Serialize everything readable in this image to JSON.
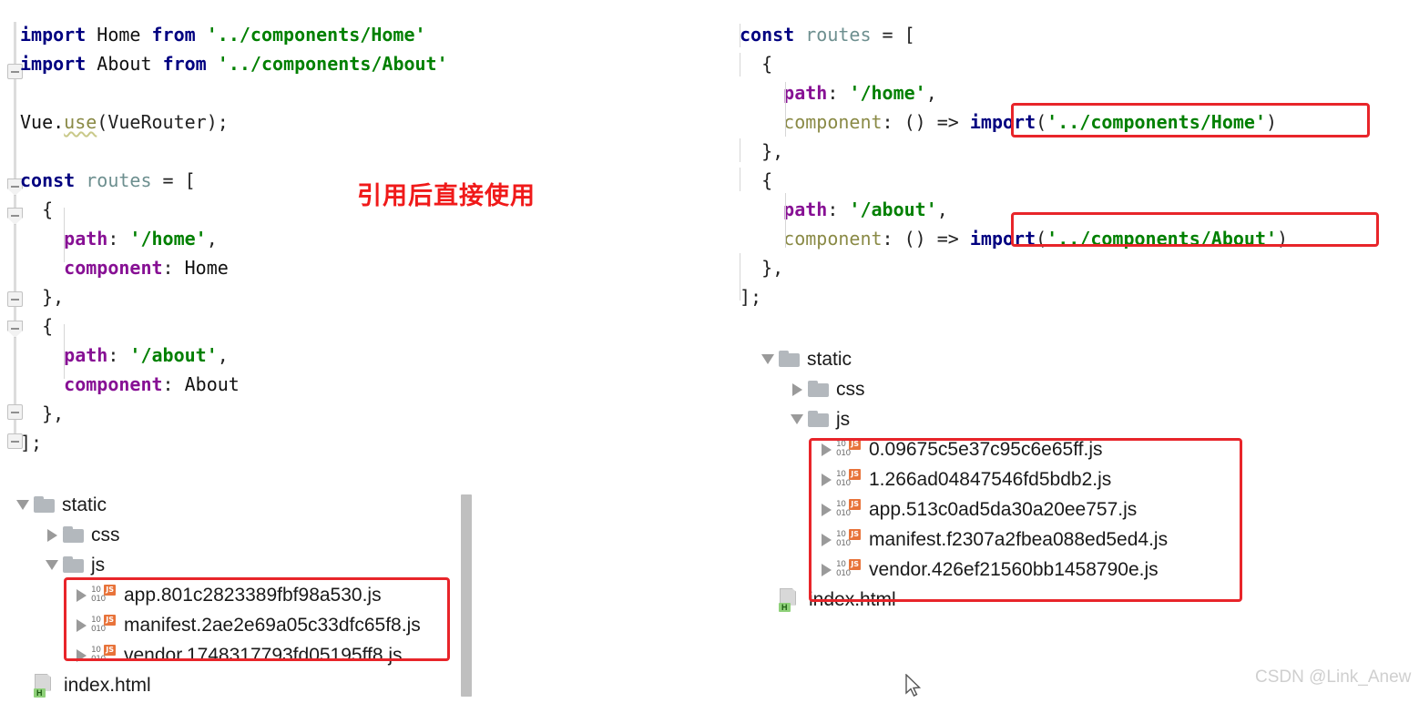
{
  "watermark": "CSDN @Link_Anew",
  "annotation": {
    "text": "引用后直接使用",
    "color": "#f01a1a"
  },
  "colors": {
    "keyword": "#000080",
    "string": "#008000",
    "property": "#871094",
    "property_dim": "#8a8a46",
    "variable": "#6d8f8f",
    "highlight_box": "#e8252a",
    "background": "#ffffff",
    "js_badge": "#e8733a",
    "html_badge": "#8fd17a",
    "folder": "#b3b8bd"
  },
  "left_editor": {
    "name": "static-import-router-code",
    "lines": [
      {
        "t": "l1",
        "tokens": [
          {
            "c": "kw",
            "s": "import"
          },
          {
            "c": "p",
            "s": " "
          },
          {
            "c": "id",
            "s": "Home"
          },
          {
            "c": "p",
            "s": " "
          },
          {
            "c": "kw",
            "s": "from"
          },
          {
            "c": "p",
            "s": " "
          },
          {
            "c": "str",
            "s": "'../components/Home'"
          }
        ]
      },
      {
        "t": "l2",
        "tokens": [
          {
            "c": "kw",
            "s": "import"
          },
          {
            "c": "p",
            "s": " "
          },
          {
            "c": "id",
            "s": "About"
          },
          {
            "c": "p",
            "s": " "
          },
          {
            "c": "kw",
            "s": "from"
          },
          {
            "c": "p",
            "s": " "
          },
          {
            "c": "str",
            "s": "'../components/About'"
          }
        ]
      },
      {
        "t": "l3",
        "tokens": []
      },
      {
        "t": "l4",
        "tokens": [
          {
            "c": "id",
            "s": "Vue."
          },
          {
            "c": "warn",
            "s": "use"
          },
          {
            "c": "p",
            "s": "(VueRouter);"
          }
        ]
      },
      {
        "t": "l5",
        "tokens": []
      },
      {
        "t": "l6",
        "tokens": [
          {
            "c": "kw",
            "s": "const"
          },
          {
            "c": "p",
            "s": " "
          },
          {
            "c": "var",
            "s": "routes"
          },
          {
            "c": "p",
            "s": " = ["
          }
        ]
      },
      {
        "t": "l7",
        "tokens": [
          {
            "c": "p",
            "s": "  {"
          }
        ]
      },
      {
        "t": "l8",
        "tokens": [
          {
            "c": "prop",
            "s": "    path"
          },
          {
            "c": "p",
            "s": ": "
          },
          {
            "c": "str",
            "s": "'/home'"
          },
          {
            "c": "p",
            "s": ","
          }
        ]
      },
      {
        "t": "l9",
        "tokens": [
          {
            "c": "prop",
            "s": "    component"
          },
          {
            "c": "p",
            "s": ": "
          },
          {
            "c": "id",
            "s": "Home"
          }
        ]
      },
      {
        "t": "l10",
        "tokens": [
          {
            "c": "p",
            "s": "  },"
          }
        ]
      },
      {
        "t": "l11",
        "tokens": [
          {
            "c": "p",
            "s": "  {"
          }
        ]
      },
      {
        "t": "l12",
        "tokens": [
          {
            "c": "prop",
            "s": "    path"
          },
          {
            "c": "p",
            "s": ": "
          },
          {
            "c": "str",
            "s": "'/about'"
          },
          {
            "c": "p",
            "s": ","
          }
        ]
      },
      {
        "t": "l13",
        "tokens": [
          {
            "c": "prop",
            "s": "    component"
          },
          {
            "c": "p",
            "s": ": "
          },
          {
            "c": "id",
            "s": "About"
          }
        ]
      },
      {
        "t": "l14",
        "tokens": [
          {
            "c": "p",
            "s": "  },"
          }
        ]
      },
      {
        "t": "l15",
        "tokens": [
          {
            "c": "p",
            "s": "];"
          }
        ]
      }
    ]
  },
  "right_editor": {
    "name": "lazy-import-router-code",
    "lines": [
      {
        "t": "r1",
        "tokens": [
          {
            "c": "kw",
            "s": "const"
          },
          {
            "c": "p",
            "s": " "
          },
          {
            "c": "var",
            "s": "routes"
          },
          {
            "c": "p",
            "s": " = ["
          }
        ]
      },
      {
        "t": "r2",
        "tokens": [
          {
            "c": "p",
            "s": "  {"
          }
        ]
      },
      {
        "t": "r3",
        "tokens": [
          {
            "c": "prop",
            "s": "    path"
          },
          {
            "c": "p",
            "s": ": "
          },
          {
            "c": "str",
            "s": "'/home'"
          },
          {
            "c": "p",
            "s": ","
          }
        ]
      },
      {
        "t": "r4",
        "tokens": [
          {
            "c": "propd",
            "s": "    component"
          },
          {
            "c": "p",
            "s": ": () => "
          },
          {
            "c": "kw",
            "s": "import"
          },
          {
            "c": "p",
            "s": "("
          },
          {
            "c": "str",
            "s": "'../components/Home'"
          },
          {
            "c": "p",
            "s": ")"
          }
        ]
      },
      {
        "t": "r5",
        "tokens": [
          {
            "c": "p",
            "s": "  },"
          }
        ]
      },
      {
        "t": "r6",
        "tokens": [
          {
            "c": "p",
            "s": "  {"
          }
        ]
      },
      {
        "t": "r7",
        "tokens": [
          {
            "c": "prop",
            "s": "    path"
          },
          {
            "c": "p",
            "s": ": "
          },
          {
            "c": "str",
            "s": "'/about'"
          },
          {
            "c": "p",
            "s": ","
          }
        ]
      },
      {
        "t": "r8",
        "tokens": [
          {
            "c": "propd",
            "s": "    component"
          },
          {
            "c": "p",
            "s": ": () => "
          },
          {
            "c": "kw",
            "s": "import"
          },
          {
            "c": "p",
            "s": "("
          },
          {
            "c": "str",
            "s": "'../components/About'"
          },
          {
            "c": "p",
            "s": ")"
          }
        ]
      },
      {
        "t": "r9",
        "tokens": [
          {
            "c": "p",
            "s": "  },"
          }
        ]
      },
      {
        "t": "r10",
        "tokens": [
          {
            "c": "p",
            "s": "];"
          }
        ]
      }
    ]
  },
  "left_tree": {
    "name": "build-output-without-lazy-loading",
    "rows": [
      {
        "label": "static",
        "icon": "folder-icon",
        "twisty": "open",
        "indent": 0
      },
      {
        "label": "css",
        "icon": "folder-icon",
        "twisty": "closed",
        "indent": 1
      },
      {
        "label": "js",
        "icon": "folder-icon",
        "twisty": "open",
        "indent": 1
      },
      {
        "label": "app.801c2823389fbf98a530.js",
        "icon": "js-icon",
        "twisty": "closed",
        "indent": 2
      },
      {
        "label": "manifest.2ae2e69a05c33dfc65f8.js",
        "icon": "js-icon",
        "twisty": "closed",
        "indent": 2
      },
      {
        "label": "vendor.1748317793fd05195ff8.js",
        "icon": "js-icon",
        "twisty": "closed",
        "indent": 2
      },
      {
        "label": "index.html",
        "icon": "html-icon",
        "twisty": "none",
        "indent": 0
      }
    ]
  },
  "right_tree": {
    "name": "build-output-with-lazy-loading",
    "rows": [
      {
        "label": "static",
        "icon": "folder-icon",
        "twisty": "open",
        "indent": 0
      },
      {
        "label": "css",
        "icon": "folder-icon",
        "twisty": "closed",
        "indent": 1
      },
      {
        "label": "js",
        "icon": "folder-icon",
        "twisty": "open",
        "indent": 1
      },
      {
        "label": "0.09675c5e37c95c6e65ff.js",
        "icon": "js-icon",
        "twisty": "closed",
        "indent": 2
      },
      {
        "label": "1.266ad04847546fd5bdb2.js",
        "icon": "js-icon",
        "twisty": "closed",
        "indent": 2
      },
      {
        "label": "app.513c0ad5da30a20ee757.js",
        "icon": "js-icon",
        "twisty": "closed",
        "indent": 2
      },
      {
        "label": "manifest.f2307a2fbea088ed5ed4.js",
        "icon": "js-icon",
        "twisty": "closed",
        "indent": 2
      },
      {
        "label": "vendor.426ef21560bb1458790e.js",
        "icon": "js-icon",
        "twisty": "closed",
        "indent": 2
      },
      {
        "label": "index.html",
        "icon": "html-icon",
        "twisty": "none",
        "indent": 0
      }
    ]
  }
}
